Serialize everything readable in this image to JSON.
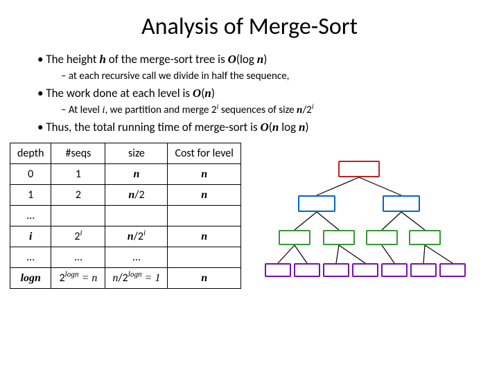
{
  "title": "Analysis of Merge-Sort",
  "bullets": {
    "b1_pre": "The height ",
    "b1_h": "h",
    "b1_mid": " of the merge-sort tree is ",
    "b1_O": "O",
    "b1_paren": "(log ",
    "b1_n": "n",
    "b1_close": ")",
    "b1a": "at each recursive call we divide in half the sequence,",
    "b2_pre": "The work done at each level is ",
    "b2_O": "O",
    "b2_paren": "(",
    "b2_n": "n",
    "b2_close": ")",
    "b2a_pre": "At level ",
    "b2a_i": "i",
    "b2a_mid": ", we partition and merge ",
    "b2a_two": "2",
    "b2a_exp_i": "i",
    "b2a_mid2": " sequences of size ",
    "b2a_n": "n",
    "b2a_slash": "/2",
    "b2a_exp_i2": "i",
    "b3_pre": "Thus, the total running time of merge-sort is ",
    "b3_O": "O",
    "b3_paren": "(",
    "b3_n1": "n",
    "b3_log": " log ",
    "b3_n2": "n",
    "b3_close": ")"
  },
  "table": {
    "h1": "depth",
    "h2": "#seqs",
    "h3": "size",
    "h4": "Cost for level",
    "r0c0": "0",
    "r0c1": "1",
    "r0c2": "n",
    "r0c3": "n",
    "r1c0": "1",
    "r1c1": "2",
    "r1c2_n": "n",
    "r1c2_s": "/2",
    "r1c3": "n",
    "r2c0": "…",
    "r3c0": "i",
    "r3c1_b": "2",
    "r3c1_e": "i",
    "r3c2_n": "n",
    "r3c2_s": "/2",
    "r3c2_e": "i",
    "r3c3": "n",
    "r4c0": "…",
    "r4c1": "…",
    "r4c2": "…",
    "r5c0": "logn",
    "r5c1_b": "2",
    "r5c1_e": "logn",
    "r5c1_eq": " = ",
    "r5c1_n": "n",
    "r5c2_n": "n",
    "r5c2_s": "/2",
    "r5c2_e": "logn",
    "r5c2_eq": " = 1",
    "r5c3": "n"
  }
}
